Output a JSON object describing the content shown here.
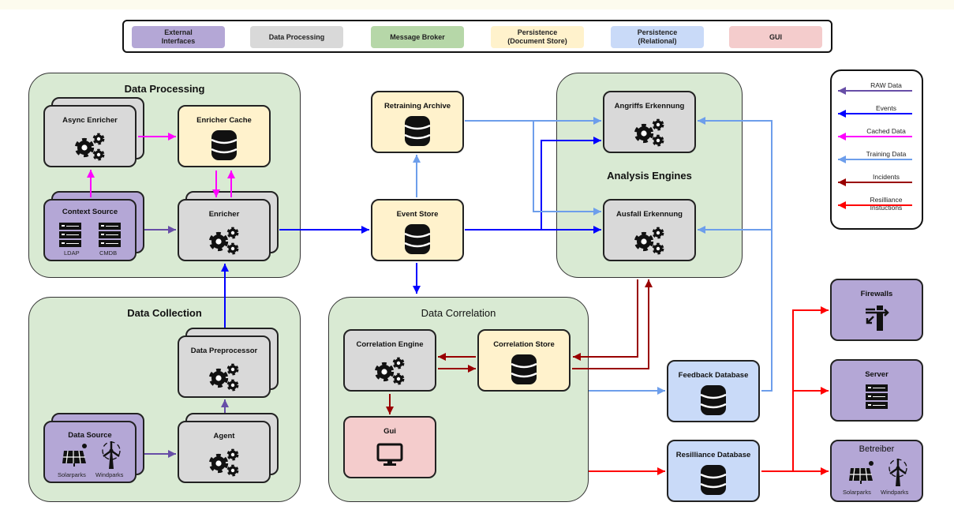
{
  "legend": {
    "items": [
      {
        "label": "External\nInterfaces",
        "color": "#b4a7d6"
      },
      {
        "label": "Data Processing",
        "color": "#d9d9d9"
      },
      {
        "label": "Message Broker",
        "color": "#b6d7a8"
      },
      {
        "label": "Persistence\n(Document Store)",
        "color": "#fff2cc"
      },
      {
        "label": "Persistence\n(Relational)",
        "color": "#c9daf8"
      },
      {
        "label": "GUI",
        "color": "#f4cccc"
      }
    ]
  },
  "groups": {
    "processing": "Data Processing",
    "collection": "Data Collection",
    "correlation": "Data Correlation",
    "analysis": "Analysis Engines"
  },
  "nodes": {
    "async_enricher": "Async Enricher",
    "enricher_cache": "Enricher Cache",
    "context_source": "Context Source",
    "ldap": "LDAP",
    "cmdb": "CMDB",
    "enricher": "Enricher",
    "data_preprocessor": "Data Preprocessor",
    "agent": "Agent",
    "data_source": "Data Source",
    "solarparks": "Solarparks",
    "windparks": "Windparks",
    "retraining_archive": "Retraining Archive",
    "event_store": "Event Store",
    "correlation_engine": "Correlation Engine",
    "correlation_store": "Correlation Store",
    "gui": "Gui",
    "angriffs": "Angriffs Erkennung",
    "ausfall": "Ausfall Erkennung",
    "feedback_db": "Feedback Database",
    "resilliance_db": "Resilliance Database",
    "firewalls": "Firewalls",
    "server": "Server",
    "betreiber": "Betreiber",
    "b_solarparks": "Solarparks",
    "b_windparks": "Windparks"
  },
  "arrow_legend": [
    {
      "label": "RAW Data",
      "color": "#674ea7"
    },
    {
      "label": "Events",
      "color": "#0000ff"
    },
    {
      "label": "Cached Data",
      "color": "#ff00ff"
    },
    {
      "label": "Training Data",
      "color": "#6d9eeb"
    },
    {
      "label": "Incidents",
      "color": "#990000"
    },
    {
      "label": "Resilliance\nInstuctions",
      "color": "#ff0000"
    }
  ]
}
